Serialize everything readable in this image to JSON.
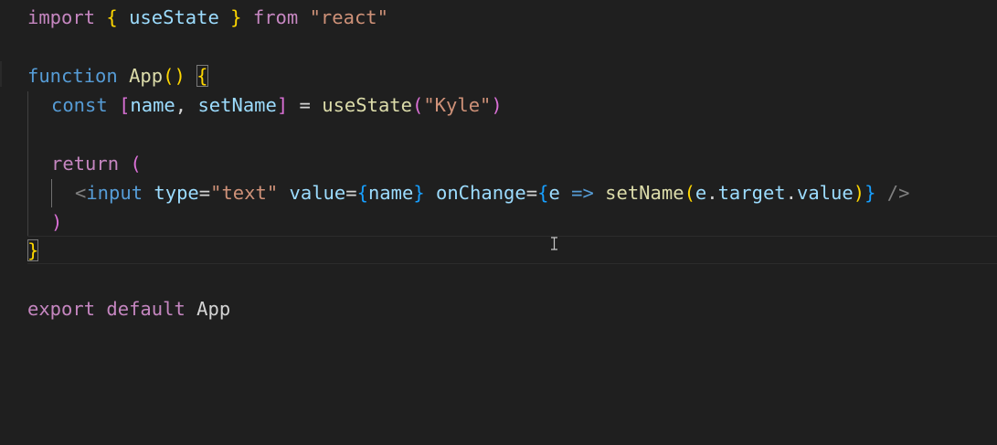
{
  "editor": {
    "lines": {
      "l1": {
        "t1": "import",
        "t2": " ",
        "t3": "{",
        "t4": " useState ",
        "t5": "}",
        "t6": " from ",
        "t7": "\"react\""
      },
      "l3": {
        "t1": "function",
        "t2": " ",
        "t3": "App",
        "t4": "()",
        "t5": " ",
        "t6": "{"
      },
      "l4": {
        "t1": "const",
        "t2": " ",
        "t3": "[",
        "t4": "name",
        "t5": ", ",
        "t6": "setName",
        "t7": "]",
        "t8": " = ",
        "t9": "useState",
        "t10": "(",
        "t11": "\"Kyle\"",
        "t12": ")"
      },
      "l6": {
        "t1": "return",
        "t2": " ",
        "t3": "("
      },
      "l7": {
        "t1": "<",
        "t2": "input",
        "t3": " ",
        "t4": "type",
        "t5": "=",
        "t6": "\"text\"",
        "t7": " ",
        "t8": "value",
        "t9": "=",
        "t10": "{",
        "t11": "name",
        "t12": "}",
        "t13": " ",
        "t14": "onChange",
        "t15": "=",
        "t16": "{",
        "t17": "e",
        "t18": " ",
        "t19": "=>",
        "t20": " ",
        "t21": "setName",
        "t22": "(",
        "t23": "e",
        "t24": ".",
        "t25": "target",
        "t26": ".",
        "t27": "value",
        "t28": ")",
        "t29": "}",
        "t30": " ",
        "t31": "/>"
      },
      "l8": {
        "t1": ")"
      },
      "l9": {
        "t1": "}"
      },
      "l11": {
        "t1": "export",
        "t2": " ",
        "t3": "default",
        "t4": " App"
      }
    },
    "cursor_icon": "text-cursor-icon",
    "colors": {
      "background": "#1f1f1f",
      "keyword_control": "#c586c0",
      "keyword": "#569cd6",
      "function": "#dcdcaa",
      "variable": "#9cdcfe",
      "string": "#ce9178",
      "bracket_gold": "#ffd700",
      "bracket_pink": "#da70d6",
      "bracket_blue": "#179fff"
    }
  }
}
